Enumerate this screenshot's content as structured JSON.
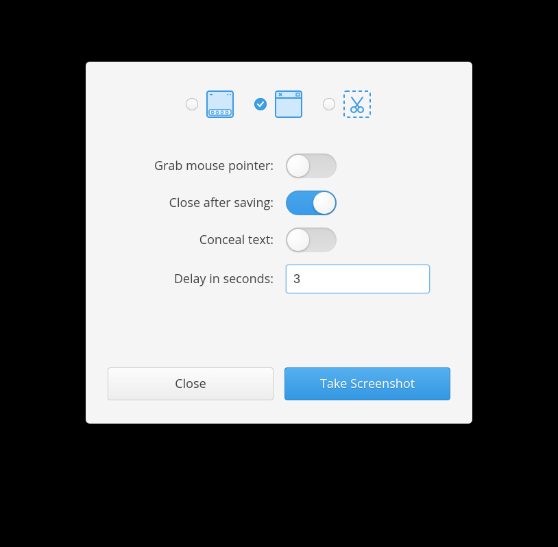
{
  "modes": {
    "screen": {
      "selected": false
    },
    "window": {
      "selected": true
    },
    "area": {
      "selected": false
    }
  },
  "options": {
    "grab_pointer": {
      "label": "Grab mouse pointer:",
      "value": false
    },
    "close_after": {
      "label": "Close after saving:",
      "value": true
    },
    "conceal_text": {
      "label": "Conceal text:",
      "value": false
    },
    "delay": {
      "label": "Delay in seconds:",
      "value": "3"
    }
  },
  "buttons": {
    "close": "Close",
    "primary": "Take Screenshot"
  },
  "colors": {
    "accent": "#3a9ae6",
    "dialog_bg": "#f5f5f5"
  }
}
